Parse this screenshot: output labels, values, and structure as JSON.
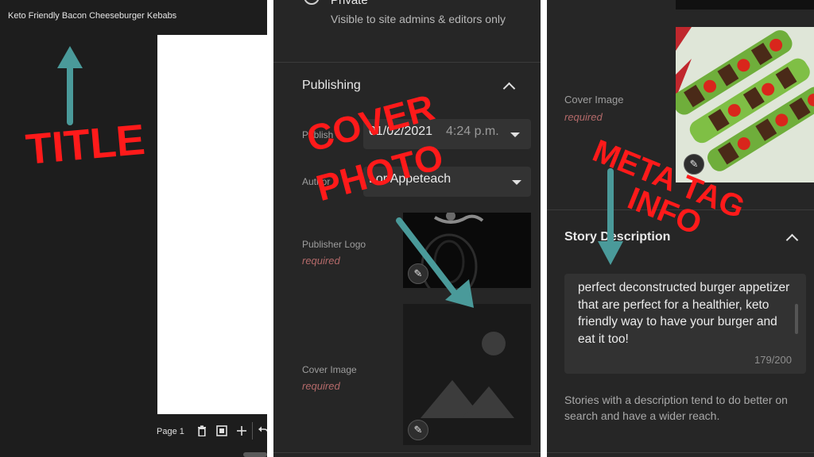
{
  "panel1": {
    "story_title": "Keto Friendly Bacon Cheeseburger Kebabs",
    "page_label": "Page 1",
    "icons": [
      "trash-icon",
      "duplicate-icon",
      "add-icon",
      "undo-icon"
    ]
  },
  "panel2": {
    "private_label": "Private",
    "private_desc": "Visible to site admins & editors only",
    "publishing": {
      "title": "Publishing",
      "publish_label": "Publish",
      "publish_date": "01/02/2021",
      "publish_time": "4:24 p.m.",
      "author_label": "Author",
      "author_value": "Lor Appeteach"
    },
    "publisher_logo": {
      "label": "Publisher Logo",
      "required": "required"
    },
    "cover_image": {
      "label": "Cover Image",
      "required": "required"
    }
  },
  "panel3": {
    "cover_image": {
      "label": "Cover Image",
      "required": "required"
    },
    "story_description": {
      "title": "Story Description",
      "text": "perfect deconstructed burger appetizer that are perfect for a healthier, keto friendly way to have your burger and eat it too!",
      "count": "179/200",
      "help": "Stories with a description tend to do better on search and have a wider reach."
    }
  },
  "annotations": {
    "title": "TITLE",
    "cover_line1": "COVER",
    "cover_line2": "PHOTO",
    "meta_line1": "META TAG",
    "meta_line2": "INFO",
    "text_color": "#ff1a1a",
    "arrow_color": "#4a9a9a"
  }
}
